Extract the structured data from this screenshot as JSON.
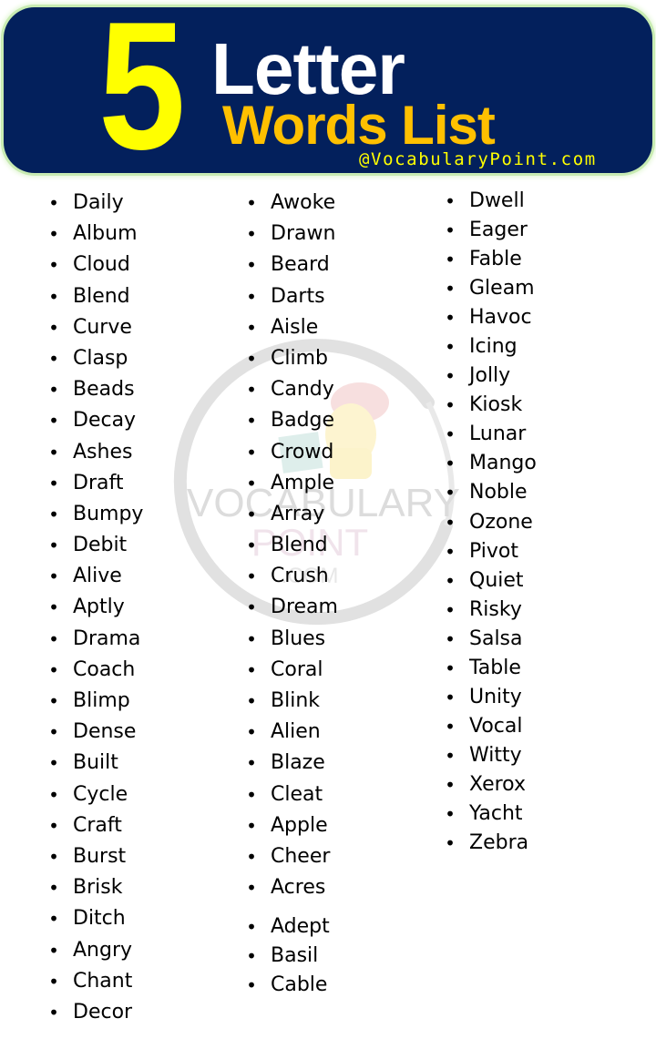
{
  "header": {
    "number": "5",
    "line1": "Letter",
    "line2": "Words List",
    "site": "@VocabularyPoint.com",
    "colors": {
      "background": "#03205c",
      "border": "#c8ebb2",
      "number": "#ffff00",
      "line1": "#ffffff",
      "line2": "#ffc000",
      "site": "#ffff00"
    }
  },
  "watermark": {
    "line1": "VOCABULARY",
    "line2": "POINT",
    "line3": ".COM"
  },
  "columns": [
    {
      "words": [
        "Daily",
        "Album",
        "Cloud",
        "Blend",
        "Curve",
        "Clasp",
        "Beads",
        "Decay",
        "Ashes",
        "Draft",
        "Bumpy",
        "Debit",
        "Alive",
        "Aptly",
        "Drama",
        "Coach",
        "Blimp",
        "Dense",
        "Built",
        "Cycle",
        "Craft",
        "Burst",
        "Brisk",
        "Ditch",
        "Angry",
        "Chant",
        "Decor"
      ]
    },
    {
      "words": [
        "Awoke",
        "Drawn",
        "Beard",
        "Darts",
        "Aisle",
        "Climb",
        "Candy",
        "Badge",
        "Crowd",
        "Ample",
        "Array",
        "Blend",
        "Crush",
        "Dream",
        "Blues",
        "Coral",
        "Blink",
        "Alien",
        "Blaze",
        "Cleat",
        "Apple",
        "Cheer",
        "Acres",
        "Adept",
        "Basil",
        "Cable"
      ]
    },
    {
      "words": [
        "Dwell",
        "Eager",
        "Fable",
        "Gleam",
        "Havoc",
        "Icing",
        "Jolly",
        "Kiosk",
        "Lunar",
        "Mango",
        "Noble",
        "Ozone",
        "Pivot",
        "Quiet",
        "Risky",
        "Salsa",
        "Table",
        "Unity",
        "Vocal",
        "Witty",
        "Xerox",
        "Yacht",
        "Zebra"
      ]
    }
  ],
  "bullet_glyph": "•"
}
